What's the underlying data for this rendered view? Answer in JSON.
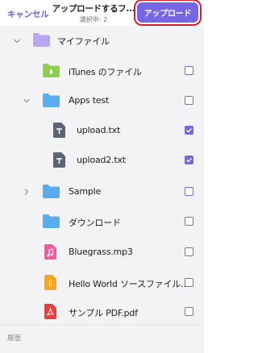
{
  "header": {
    "cancel_label": "キャンセル",
    "title": "アップロードするフ...",
    "subtitle": "選択中: 2",
    "upload_label": "アップロード"
  },
  "colors": {
    "accent": "#7766e3",
    "highlight": "#e0192a"
  },
  "items": [
    {
      "label": "マイファイル",
      "kind": "folder",
      "folder_color": "#b6a6f3",
      "chevron": "down",
      "checkbox": false
    },
    {
      "label": "iTunes のファイル",
      "kind": "folder-itunes",
      "folder_color": "#8dd04e",
      "chevron": "",
      "checkbox": true,
      "checked": false
    },
    {
      "label": "Apps test",
      "kind": "folder",
      "folder_color": "#5aacf0",
      "chevron": "down",
      "checkbox": true,
      "checked": false
    },
    {
      "label": "upload.txt",
      "kind": "text-file",
      "icon": "text-file-icon",
      "checkbox": true,
      "checked": true
    },
    {
      "label": "upload2.txt",
      "kind": "text-file",
      "icon": "text-file-icon",
      "checkbox": true,
      "checked": true
    },
    {
      "label": "Sample",
      "kind": "folder",
      "folder_color": "#5aacf0",
      "chevron": "right",
      "checkbox": true,
      "checked": false
    },
    {
      "label": "ダウンロード",
      "kind": "folder",
      "folder_color": "#5aacf0",
      "chevron": "",
      "checkbox": true,
      "checked": false
    },
    {
      "label": "Bluegrass.mp3",
      "kind": "audio-file",
      "icon": "audio-file-icon",
      "checkbox": true,
      "checked": false
    },
    {
      "label": "Hello World ソースファイル...",
      "kind": "code-file",
      "icon": "code-file-icon",
      "checkbox": true,
      "checked": false
    },
    {
      "label": "サンプル PDF.pdf",
      "kind": "pdf-file",
      "icon": "pdf-file-icon",
      "checkbox": true,
      "checked": false
    }
  ],
  "footer": {
    "history_label": "履歴"
  }
}
